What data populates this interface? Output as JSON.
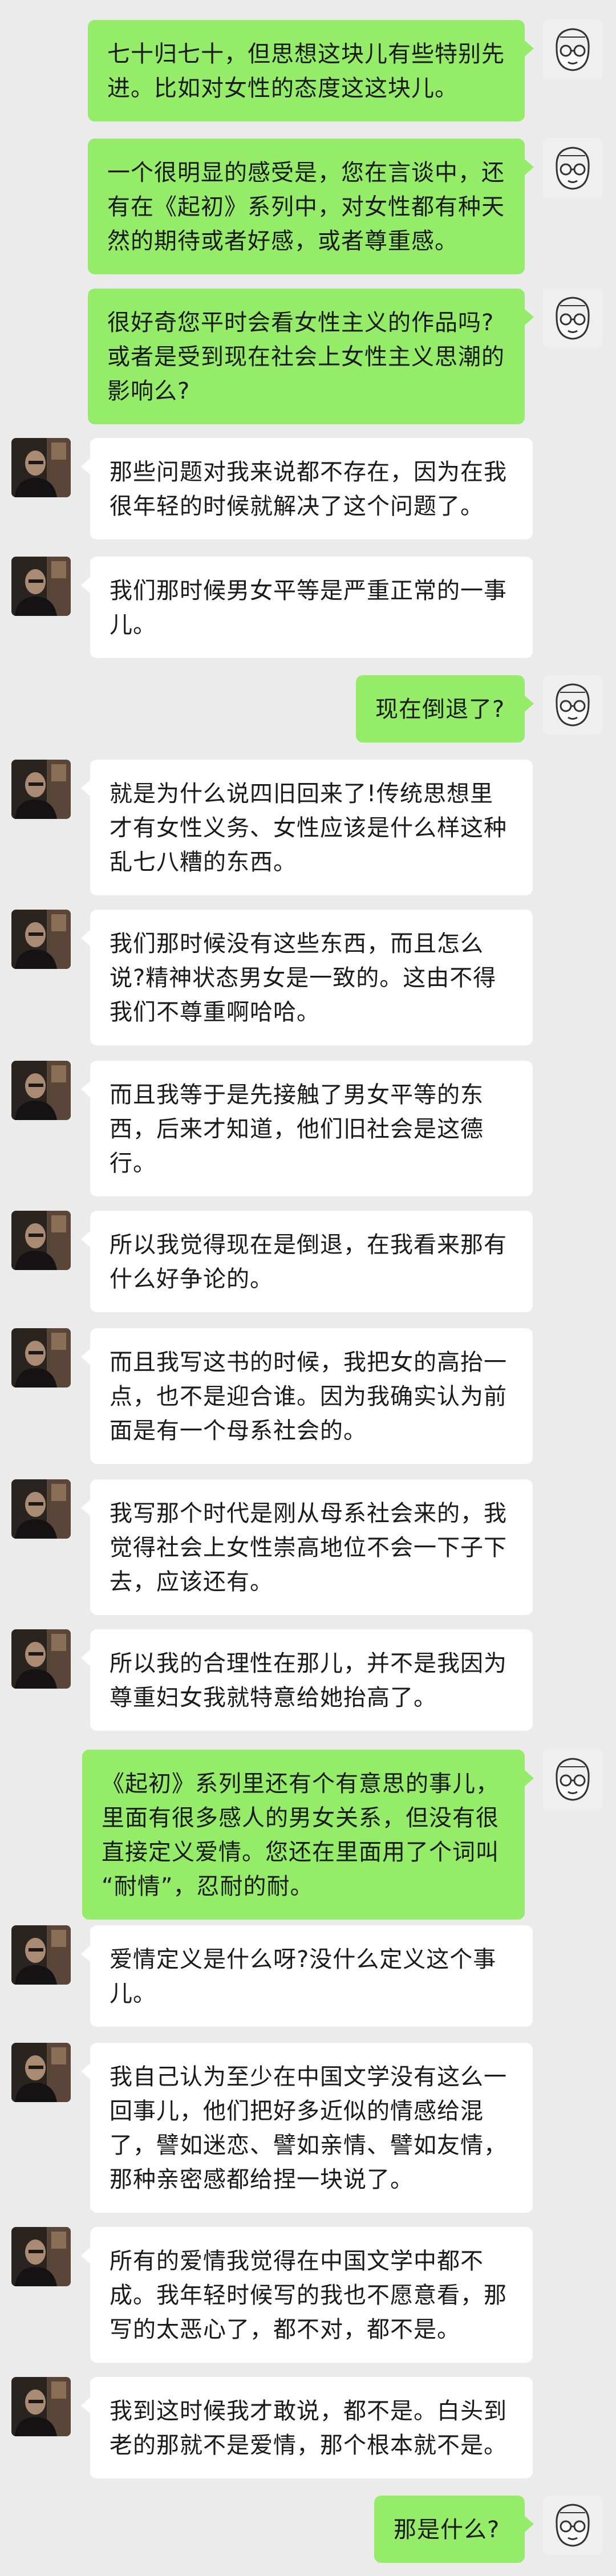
{
  "colors": {
    "background": "#ebebeb",
    "sent_bubble": "#95ec69",
    "received_bubble": "#ffffff",
    "text": "#1a1a1a"
  },
  "avatars": {
    "self_icon": "cartoon-face-glasses-icon",
    "other_icon": "author-photo-icon"
  },
  "messages": [
    {
      "side": "right",
      "lines": [
        "七十归七十，但思想这块儿有些特别先",
        "进。比如对女性的态度这这块儿。"
      ]
    },
    {
      "side": "right",
      "lines": [
        "一个很明显的感受是，您在言谈中，还",
        "有在《起初》系列中，对女性都有种天",
        "然的期待或者好感，或者尊重感。"
      ]
    },
    {
      "side": "right",
      "lines": [
        "很好奇您平时会看女性主义的作品吗?",
        "或者是受到现在社会上女性主义思潮的",
        "影响么?"
      ]
    },
    {
      "side": "left",
      "lines": [
        "那些问题对我来说都不存在，因为在我",
        "很年轻的时候就解决了这个问题了。"
      ]
    },
    {
      "side": "left",
      "lines": [
        "我们那时候男女平等是严重正常的一事",
        "儿。"
      ]
    },
    {
      "side": "right",
      "lines": [
        "现在倒退了?"
      ]
    },
    {
      "side": "left",
      "lines": [
        "就是为什么说四旧回来了!传统思想里",
        "才有女性义务、女性应该是什么样这种",
        "乱七八糟的东西。"
      ]
    },
    {
      "side": "left",
      "lines": [
        "我们那时候没有这些东西，而且怎么",
        "说?精神状态男女是一致的。这由不得",
        "我们不尊重啊哈哈。"
      ]
    },
    {
      "side": "left",
      "lines": [
        "而且我等于是先接触了男女平等的东",
        "西，后来才知道，他们旧社会是这德",
        "行。"
      ]
    },
    {
      "side": "left",
      "lines": [
        "所以我觉得现在是倒退，在我看来那有",
        "什么好争论的。"
      ]
    },
    {
      "side": "left",
      "lines": [
        "而且我写这书的时候，我把女的高抬一",
        "点，也不是迎合谁。因为我确实认为前",
        "面是有一个母系社会的。"
      ]
    },
    {
      "side": "left",
      "lines": [
        "我写那个时代是刚从母系社会来的，我",
        "觉得社会上女性崇高地位不会一下子下",
        "去，应该还有。"
      ]
    },
    {
      "side": "left",
      "lines": [
        "所以我的合理性在那儿，并不是我因为",
        "尊重妇女我就特意给她抬高了。"
      ]
    },
    {
      "side": "right",
      "lines": [
        "《起初》系列里还有个有意思的事儿，",
        "里面有很多感人的男女关系，但没有很",
        "直接定义爱情。您还在里面用了个词叫",
        "“耐情”，忍耐的耐。"
      ]
    },
    {
      "side": "left",
      "lines": [
        "爱情定义是什么呀?没什么定义这个事",
        "儿。"
      ]
    },
    {
      "side": "left",
      "lines": [
        "我自己认为至少在中国文学没有这么一",
        "回事儿，他们把好多近似的情感给混",
        "了，譬如迷恋、譬如亲情、譬如友情，",
        "那种亲密感都给捏一块说了。"
      ]
    },
    {
      "side": "left",
      "lines": [
        "所有的爱情我觉得在中国文学中都不",
        "成。我年轻时候写的我也不愿意看，那",
        "写的太恶心了，都不对，都不是。"
      ]
    },
    {
      "side": "left",
      "lines": [
        "我到这时候我才敢说，都不是。白头到",
        "老的那就不是爱情，那个根本就不是。"
      ]
    },
    {
      "side": "right",
      "lines": [
        "那是什么?"
      ]
    }
  ]
}
